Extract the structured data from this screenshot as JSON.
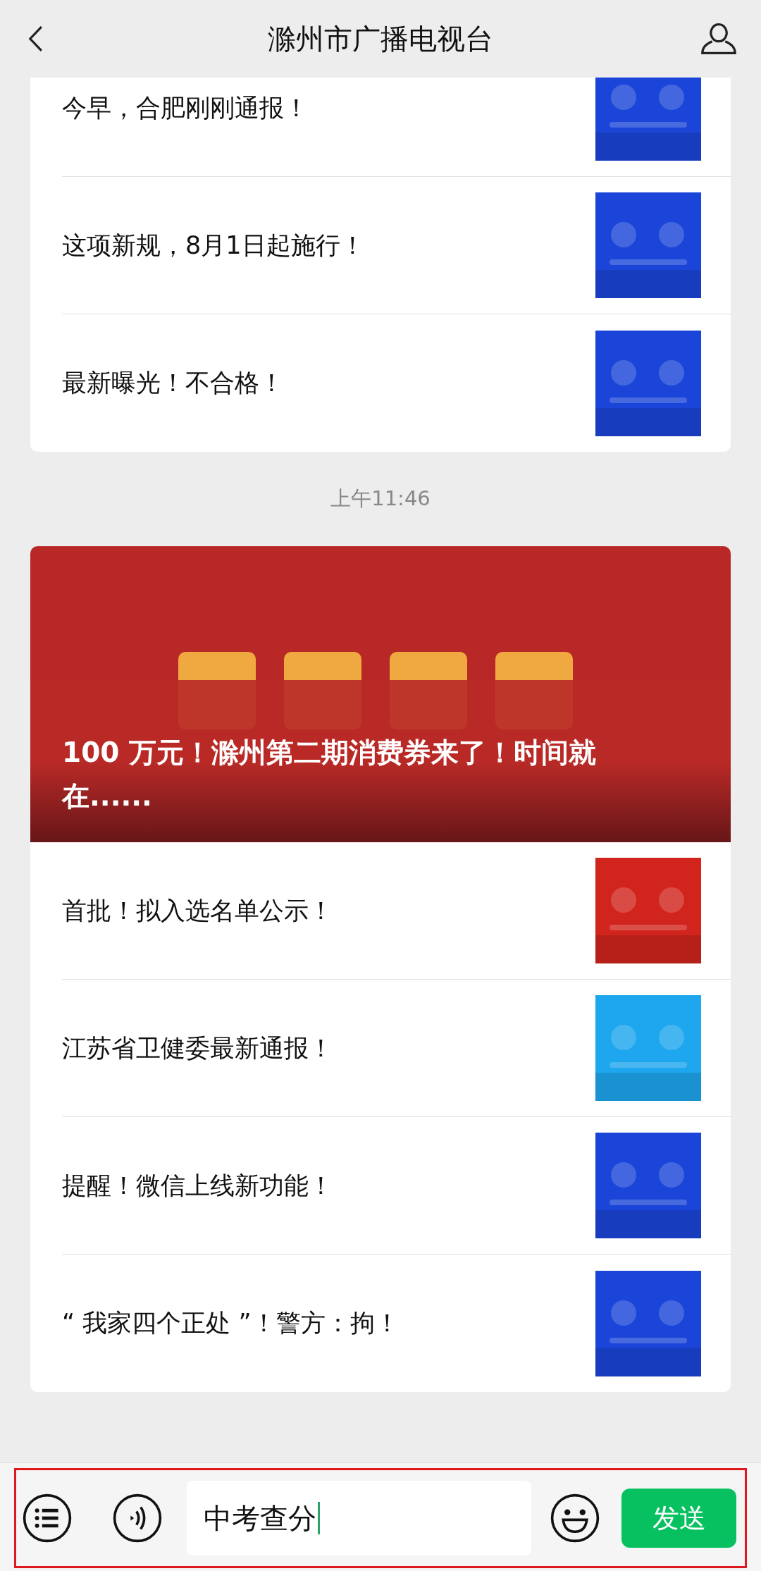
{
  "header": {
    "title": "滁州市广播电视台"
  },
  "messages": [
    {
      "kind": "list",
      "items": [
        {
          "title": "今早，合肥刚刚通报！",
          "color": "#1b45d8"
        },
        {
          "title": "这项新规，8月1日起施行！",
          "color": "#1b45d8"
        },
        {
          "title": "最新曝光！不合格！",
          "color": "#1b45d8"
        }
      ]
    },
    {
      "kind": "time",
      "text": "上午11:46"
    },
    {
      "kind": "hero",
      "title": "100 万元！滁州第二期消费券来了！时间就在......",
      "items": [
        {
          "title": "首批！拟入选名单公示！",
          "color": "#d1241d"
        },
        {
          "title": "江苏省卫健委最新通报！",
          "color": "#1ea6ee"
        },
        {
          "title": "提醒！微信上线新功能！",
          "color": "#1b45d8"
        },
        {
          "title": "“ 我家四个正处 ”！警方：拘！",
          "color": "#1b45d8"
        }
      ]
    }
  ],
  "composer": {
    "value": "中考查分",
    "send": "发送",
    "highlighted": true
  }
}
